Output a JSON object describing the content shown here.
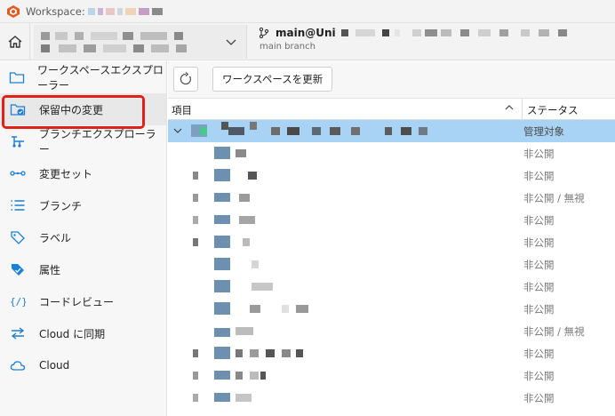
{
  "titlebar": {
    "prefix": "Workspace:"
  },
  "topbar": {
    "branch_name": "main@Uni",
    "branch_sub": "main branch"
  },
  "sidebar": {
    "items": [
      {
        "label": "ワークスペースエクスプローラー",
        "icon": "folder-icon"
      },
      {
        "label": "保留中の変更",
        "icon": "pending-changes-icon"
      },
      {
        "label": "ブランチエクスプローラー",
        "icon": "branch-explorer-icon"
      },
      {
        "label": "変更セット",
        "icon": "changeset-icon"
      },
      {
        "label": "ブランチ",
        "icon": "list-icon"
      },
      {
        "label": "ラベル",
        "icon": "label-icon"
      },
      {
        "label": "属性",
        "icon": "attribute-icon"
      },
      {
        "label": "コードレビュー",
        "icon": "code-review-icon"
      },
      {
        "label": "Cloud に同期",
        "icon": "sync-icon"
      },
      {
        "label": "Cloud",
        "icon": "cloud-icon"
      }
    ]
  },
  "toolbar": {
    "update_label": "ワークスペースを更新"
  },
  "table": {
    "col_item": "項目",
    "col_status": "ステータス",
    "rows": [
      {
        "status": "管理対象"
      },
      {
        "status": "非公開"
      },
      {
        "status": "非公開"
      },
      {
        "status": "非公開 / 無視"
      },
      {
        "status": "非公開"
      },
      {
        "status": "非公開"
      },
      {
        "status": "非公開"
      },
      {
        "status": "非公開"
      },
      {
        "status": "非公開"
      },
      {
        "status": "非公開 / 無視"
      },
      {
        "status": "非公開"
      },
      {
        "status": "非公開"
      },
      {
        "status": "非公開"
      }
    ]
  },
  "colors": {
    "accent": "#1c7fd6",
    "selection": "#a8d3f5",
    "highlight_border": "#e0211a"
  }
}
